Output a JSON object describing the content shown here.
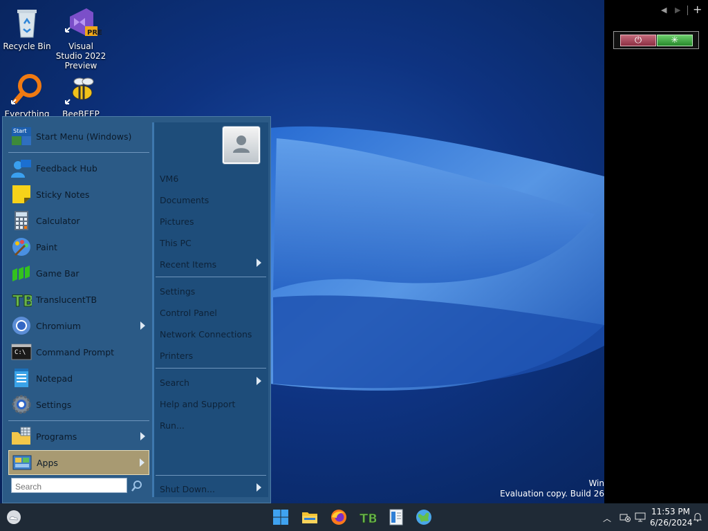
{
  "desktop": {
    "icons": [
      {
        "label": "Recycle Bin"
      },
      {
        "label": "Visual Studio 2022 Preview",
        "badge": "PRE"
      },
      {
        "label": "Everything"
      },
      {
        "label": "BeeBEEP"
      }
    ],
    "watermark": {
      "line1": "Win",
      "line2": "Evaluation copy. Build 26"
    }
  },
  "start_menu": {
    "left_items": [
      {
        "label": "Start Menu (Windows)",
        "icon": "start-menu-icon"
      },
      {
        "label": "Feedback Hub",
        "icon": "feedback-hub-icon"
      },
      {
        "label": "Sticky Notes",
        "icon": "sticky-notes-icon"
      },
      {
        "label": "Calculator",
        "icon": "calculator-icon"
      },
      {
        "label": "Paint",
        "icon": "paint-icon"
      },
      {
        "label": "Game Bar",
        "icon": "game-bar-icon"
      },
      {
        "label": "TranslucentTB",
        "icon": "translucenttb-icon"
      },
      {
        "label": "Chromium",
        "icon": "chromium-icon",
        "has_submenu": true
      },
      {
        "label": "Command Prompt",
        "icon": "command-prompt-icon",
        "icon_text": "C:\\"
      },
      {
        "label": "Notepad",
        "icon": "notepad-icon"
      },
      {
        "label": "Settings",
        "icon": "settings-gear-icon"
      },
      {
        "label": "Programs",
        "icon": "programs-folder-icon",
        "has_submenu": true
      },
      {
        "label": "Apps",
        "icon": "apps-icon",
        "has_submenu": true,
        "highlighted": true
      }
    ],
    "search": {
      "placeholder": "Search"
    },
    "right_items": [
      {
        "label": "VM6"
      },
      {
        "label": "Documents"
      },
      {
        "label": "Pictures"
      },
      {
        "label": "This PC"
      },
      {
        "label": "Recent Items",
        "has_submenu": true
      },
      {
        "label": "Settings"
      },
      {
        "label": "Control Panel"
      },
      {
        "label": "Network Connections"
      },
      {
        "label": "Printers"
      },
      {
        "label": "Search",
        "has_submenu": true
      },
      {
        "label": "Help and Support"
      },
      {
        "label": "Run..."
      },
      {
        "label": "Shut Down...",
        "has_submenu": true
      }
    ],
    "start_icon_text": "Start"
  },
  "side_panel": {
    "add_label": "+"
  },
  "taskbar": {
    "pinned": [
      {
        "icon": "windows-start-icon"
      },
      {
        "icon": "file-explorer-icon"
      },
      {
        "icon": "firefox-icon"
      },
      {
        "icon": "translucenttb-icon"
      },
      {
        "icon": "notepad-icon"
      },
      {
        "icon": "globe-icon"
      }
    ],
    "clock": {
      "time": "11:53 PM",
      "date": "6/26/2024"
    }
  },
  "colors": {
    "start_menu_bg": "#2b5a86",
    "apps_highlight": "#a89a72",
    "taskbar_bg": "#1f2a36",
    "power_red": "#8c2f43",
    "restart_green": "#27892b"
  }
}
